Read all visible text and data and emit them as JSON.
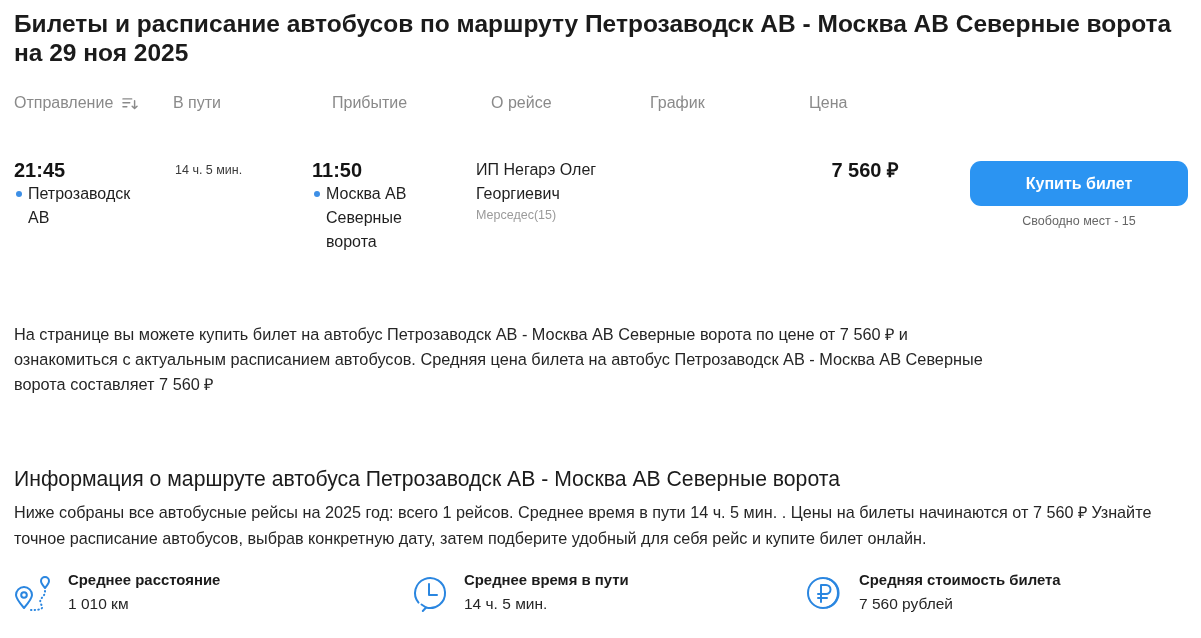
{
  "title": "Билеты и расписание автобусов по маршруту Петрозаводск АВ - Москва АВ Северные ворота на 29 ноя 2025",
  "table": {
    "columns": [
      {
        "label": "Отправление",
        "sortable": true
      },
      {
        "label": "В пути",
        "sortable": false
      },
      {
        "label": "Прибытие",
        "sortable": false
      },
      {
        "label": "О рейсе",
        "sortable": false
      },
      {
        "label": "График",
        "sortable": false
      },
      {
        "label": "Цена",
        "sortable": false
      }
    ],
    "rows": [
      {
        "departure_time": "21:45",
        "departure_station": "Петрозаводск АВ",
        "duration": "14 ч. 5 мин.",
        "arrival_time": "11:50",
        "arrival_station": "Москва АВ Северные ворота",
        "carrier": "ИП Негарэ Олег Георгиевич",
        "bus": "Мерседес(15)",
        "price": "7 560 ₽",
        "buy_button": "Купить билет",
        "seats": "Свободно мест - 15"
      }
    ]
  },
  "description": "На странице вы можете купить билет на автобус Петрозаводск АВ - Москва АВ Северные ворота по цене от 7 560 ₽ и ознакомиться с актуальным расписанием автобусов. Средняя цена билета на автобус Петрозаводск АВ - Москва АВ Северные ворота составляет 7 560 ₽",
  "route_info": {
    "heading": "Информация о маршруте автобуса Петрозаводск АВ - Москва АВ Северные ворота",
    "text": "Ниже собраны все автобусные рейсы на 2025 год: всего 1 рейсов. Среднее время в пути 14 ч. 5 мин. . Цены на билеты начинаются от 7 560 ₽ Узнайте точное расписание автобусов, выбрав конкретную дату, затем подберите удобный для себя рейс и купите билет онлайн.",
    "stats": [
      {
        "kind": "distance",
        "label": "Среднее расстояние",
        "value": "1 010 км"
      },
      {
        "kind": "time",
        "label": "Среднее время в пути",
        "value": "14 ч. 5 мин."
      },
      {
        "kind": "cost",
        "label": "Средняя стоимость билета",
        "value": "7 560 рублей"
      }
    ]
  }
}
